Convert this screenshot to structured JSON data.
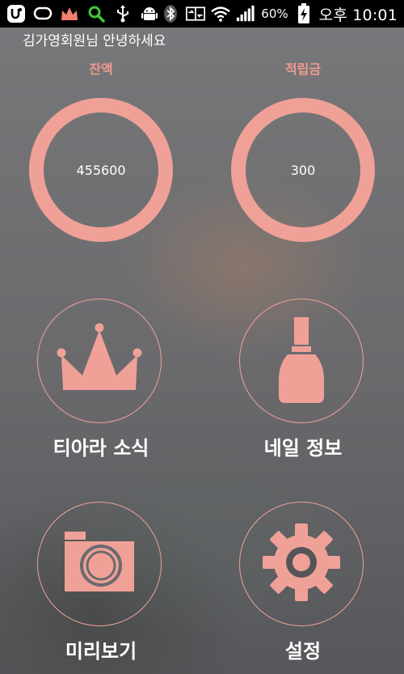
{
  "status_bar": {
    "icons_left": [
      "u-plus-icon",
      "chat-bubble-icon",
      "crown-icon",
      "search-icon",
      "usb-icon",
      "android-icon"
    ],
    "icons_right": [
      "bluetooth-icon",
      "data-transfer-icon",
      "wifi-icon",
      "signal-icon",
      "battery-charging-icon"
    ],
    "battery": "60%",
    "time": "오후 10:01"
  },
  "greeting": "김가영회원님 안녕하세요",
  "stats": {
    "balance": {
      "label": "잔액",
      "value": "455600"
    },
    "points": {
      "label": "적립금",
      "value": "300"
    }
  },
  "menu": [
    {
      "label": "티아라 소식",
      "icon": "crown-icon"
    },
    {
      "label": "네일 정보",
      "icon": "nail-polish-icon"
    },
    {
      "label": "미리보기",
      "icon": "camera-icon"
    },
    {
      "label": "설정",
      "icon": "gear-icon"
    }
  ],
  "colors": {
    "accent": "#f0a197",
    "label_accent": "#f09a8d",
    "text": "#ffffff",
    "status_bar": "#000000"
  }
}
